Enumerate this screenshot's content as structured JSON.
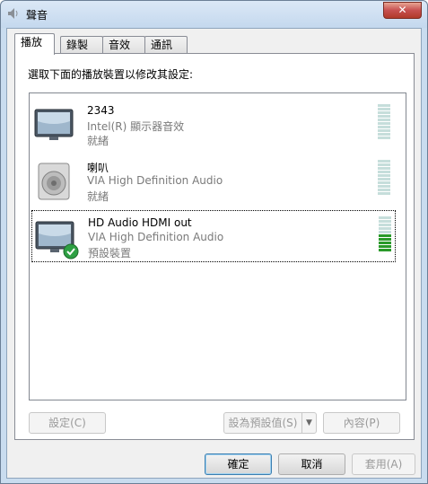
{
  "window": {
    "title": "聲音",
    "close_glyph": "✕"
  },
  "tabs": [
    {
      "label": "播放",
      "active": true
    },
    {
      "label": "錄製",
      "active": false
    },
    {
      "label": "音效",
      "active": false
    },
    {
      "label": "通訊",
      "active": false
    }
  ],
  "instruction": "選取下面的播放裝置以修改其設定:",
  "devices": [
    {
      "name": "2343",
      "desc": "Intel(R) 顯示器音效",
      "status": "就緒",
      "icon": "monitor-icon",
      "level": 0,
      "default": false
    },
    {
      "name": "喇叭",
      "desc": "VIA High Definition Audio",
      "status": "就緒",
      "icon": "speaker-icon",
      "level": 0,
      "default": false
    },
    {
      "name": "HD Audio HDMI out",
      "desc": "VIA High Definition Audio",
      "status": "預設裝置",
      "icon": "monitor-icon",
      "level": 0.5,
      "default": true
    }
  ],
  "panel_buttons": {
    "configure": "設定(C)",
    "set_default": "設為預設值(S)",
    "properties": "內容(P)"
  },
  "dialog_buttons": {
    "ok": "確定",
    "cancel": "取消",
    "apply": "套用(A)"
  },
  "colors": {
    "meter_lit": "#2a9a2a",
    "meter_idle": "#c6dedb",
    "check": "#2ea043"
  }
}
